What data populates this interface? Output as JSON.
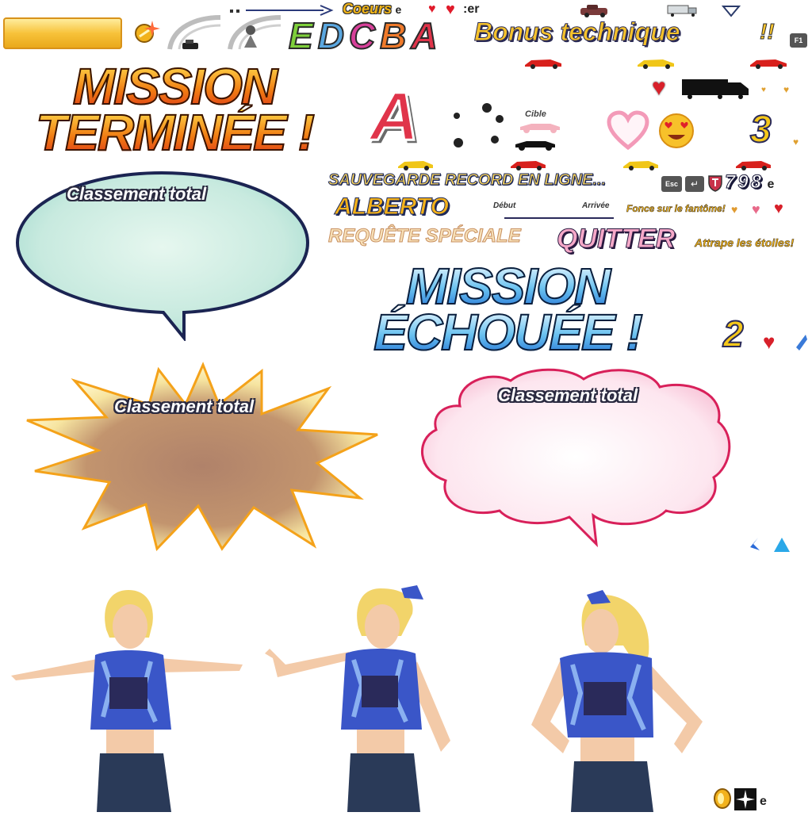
{
  "top_row": {
    "hearts_label": "Coeurs",
    "hearts_suffix": "e",
    "heart_multiplier": ":er",
    "grades": [
      "E",
      "D",
      "C",
      "B",
      "A"
    ],
    "grade_colors": [
      "#7ecf3a",
      "#5aa7e0",
      "#d8409a",
      "#f07a2a",
      "#e0344a"
    ],
    "bonus_label": "Bonus technique",
    "exclaim": "!!",
    "f1_key": "F1"
  },
  "mission_complete": {
    "line1": "MISSION",
    "line2": "TERMINÉE !",
    "bubble_label": "Classement total",
    "bubble_color": "#c8eadf"
  },
  "grade_display": {
    "letter": "A",
    "target_label": "Cible",
    "count_3": "3"
  },
  "ui_texts": {
    "save_record": "SAUVEGARDE RECORD EN LIGNE...",
    "key_esc": "Esc",
    "score_digits": "798",
    "score_suffix": "e",
    "driver_name": "ALBERTO",
    "start_label": "Début",
    "finish_label": "Arrivée",
    "ghost_hint": "Fonce sur le fantôme!",
    "special_request": "REQUÊTE SPÉCIALE",
    "quit_label": "QUITTER",
    "stars_hint": "Attrape les étoiles!"
  },
  "mission_failed": {
    "line1": "MISSION",
    "line2": "ÉCHOUÉE !",
    "count_2": "2",
    "burst_label": "Classement total",
    "cloud_label": "Classement total"
  },
  "bottom": {
    "coin_suffix": "e"
  }
}
